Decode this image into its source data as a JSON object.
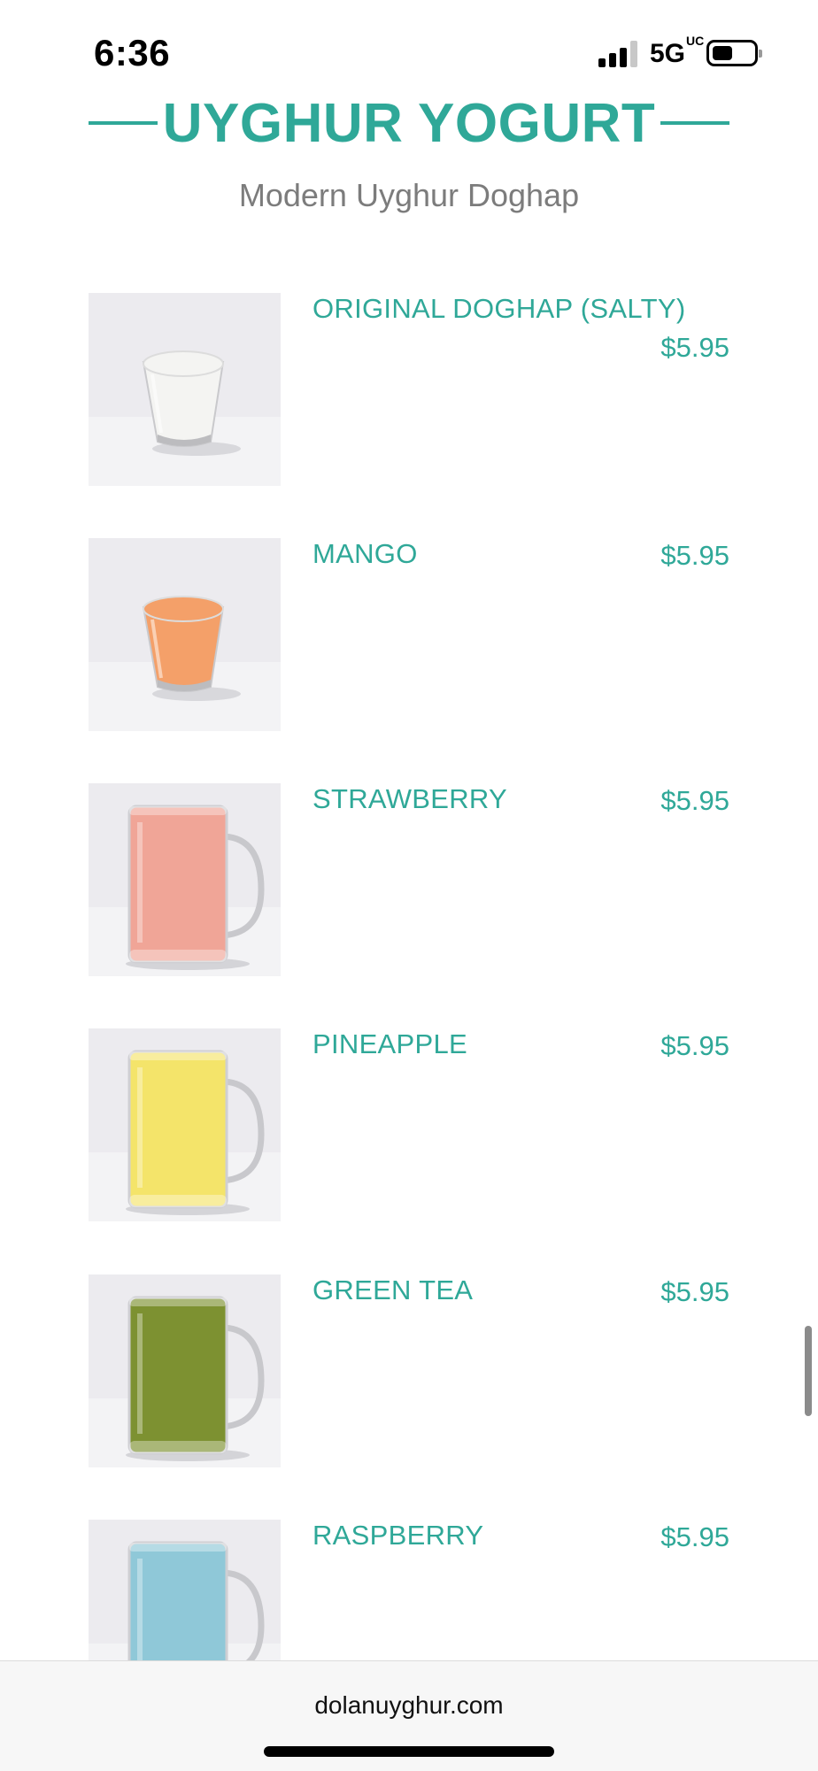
{
  "status_bar": {
    "time": "6:36",
    "network": "5G",
    "network_suffix": "UC"
  },
  "section": {
    "title": "UYGHUR YOGURT",
    "subtitle": "Modern Uyghur Doghap"
  },
  "menu_items": [
    {
      "name": "ORIGINAL DOGHAP (SALTY)",
      "price": "$5.95",
      "drink_color": "#f4f4f2",
      "glass": "tumbler"
    },
    {
      "name": "MANGO",
      "price": "$5.95",
      "drink_color": "#f4a069",
      "glass": "tumbler"
    },
    {
      "name": "STRAWBERRY",
      "price": "$5.95",
      "drink_color": "#f0a597",
      "glass": "mug"
    },
    {
      "name": "PINEAPPLE",
      "price": "$5.95",
      "drink_color": "#f4e46a",
      "glass": "mug"
    },
    {
      "name": "GREEN TEA",
      "price": "$5.95",
      "drink_color": "#7d9131",
      "glass": "mug"
    },
    {
      "name": "RASPBERRY",
      "price": "$5.95",
      "drink_color": "#8fc8d8",
      "glass": "mug"
    }
  ],
  "browser": {
    "url": "dolanuyghur.com"
  },
  "colors": {
    "accent": "#2fa898",
    "subtitle": "#7c7c7c"
  }
}
